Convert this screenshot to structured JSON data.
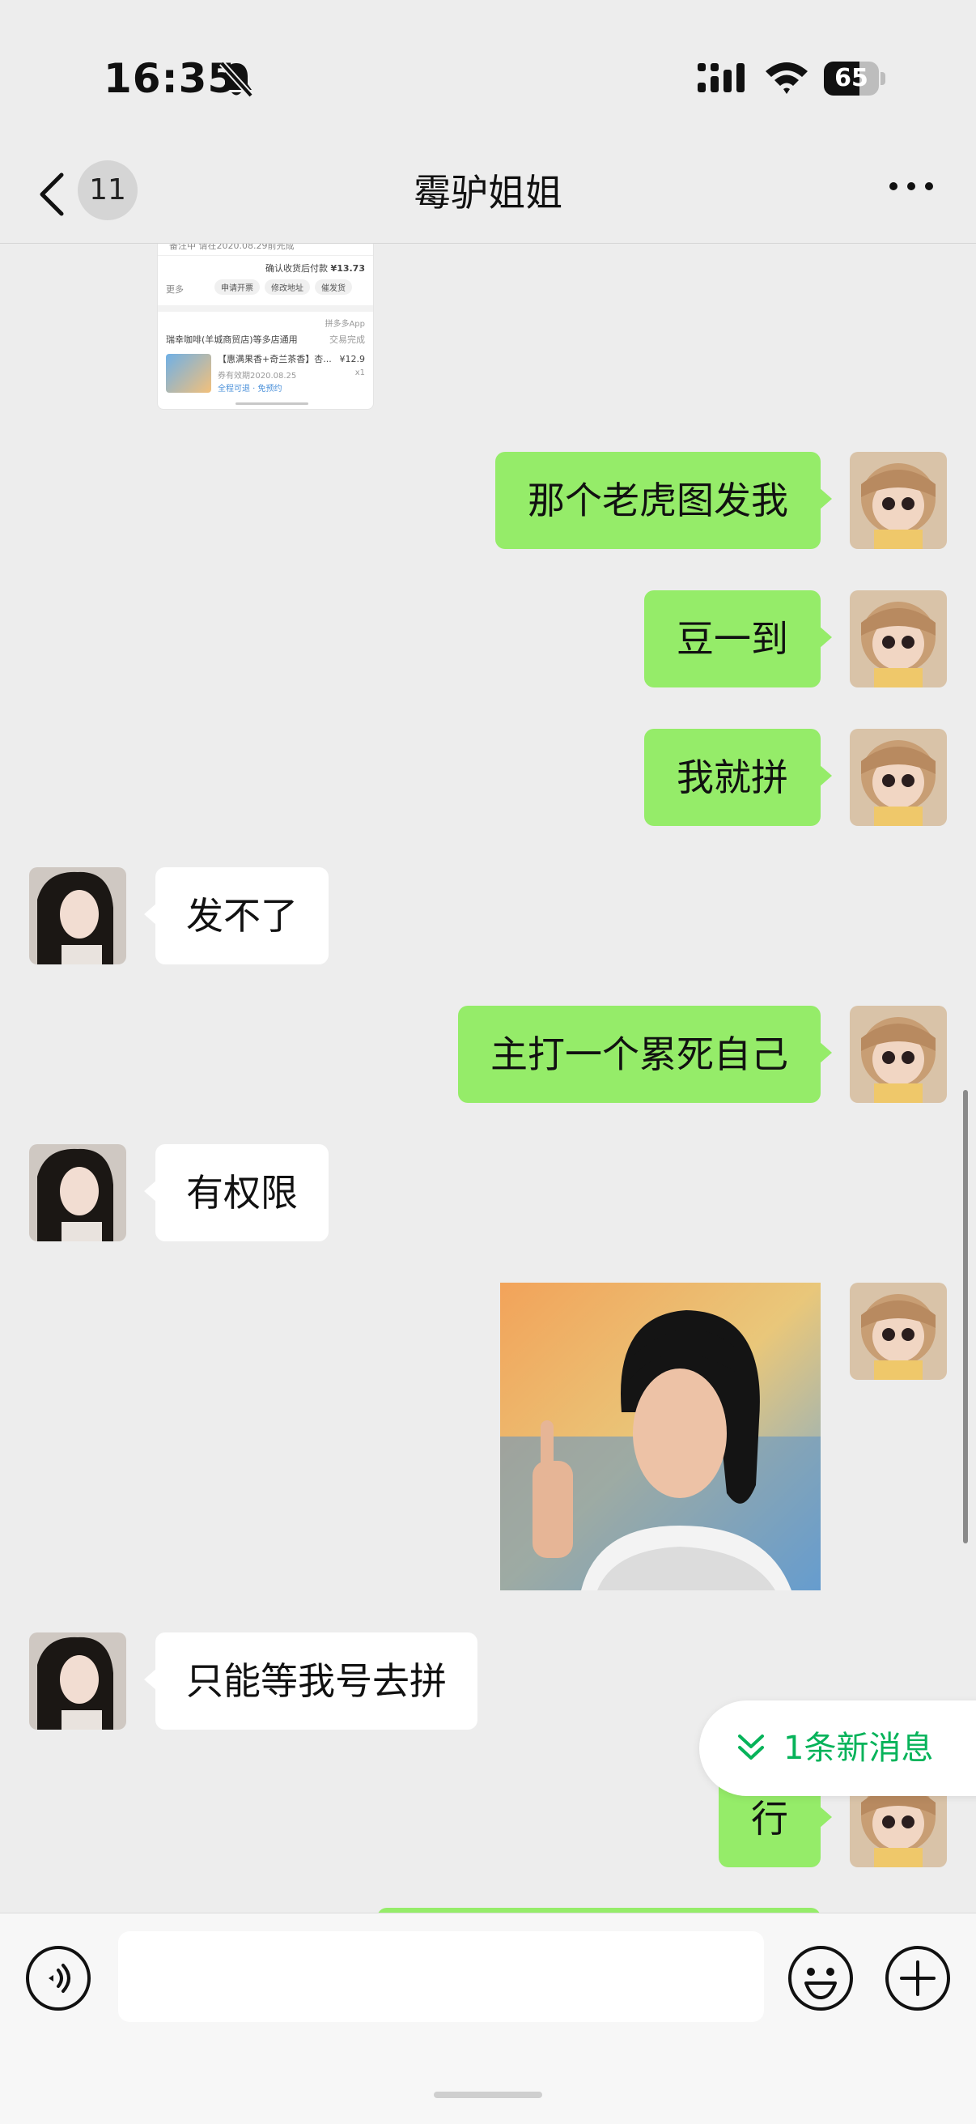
{
  "status": {
    "time": "16:35",
    "battery": "65",
    "battery_level": 0.65
  },
  "nav": {
    "unread_count": "11",
    "title": "霉驴姐姐"
  },
  "order_card": {
    "line1": "备注中 请在2020.08.29前完成",
    "confirm_label": "确认收货后付款",
    "confirm_price": "¥13.73",
    "more": "更多",
    "btn1": "申请开票",
    "btn2": "修改地址",
    "btn3": "催发货",
    "app_note": "拼多多App",
    "shop": "瑞幸咖啡(羊城商贸店)等多店通用",
    "status": "交易完成",
    "product": "【惠满果香+奇兰茶香】杏...",
    "product_price": "¥12.9",
    "date": "券有效期2020.08.25",
    "qty": "x1",
    "tags": "全程可退 · 免预约"
  },
  "messages": [
    {
      "side": "out",
      "text": "那个老虎图发我"
    },
    {
      "side": "out",
      "text": "豆一到"
    },
    {
      "side": "out",
      "text": "我就拼"
    },
    {
      "side": "in",
      "text": "发不了"
    },
    {
      "side": "out",
      "text": "主打一个累死自己"
    },
    {
      "side": "in",
      "text": "有权限"
    },
    {
      "side": "out",
      "type": "image",
      "text": ""
    },
    {
      "side": "in",
      "text": "只能等我号去拼"
    },
    {
      "side": "out",
      "text": "行"
    }
  ],
  "new_messages": {
    "label": "1条新消息"
  },
  "input": {
    "placeholder": ""
  },
  "colors": {
    "outgoing_bubble": "#95ec69",
    "incoming_bubble": "#ffffff",
    "background": "#ededed",
    "accent": "#07b35a"
  }
}
